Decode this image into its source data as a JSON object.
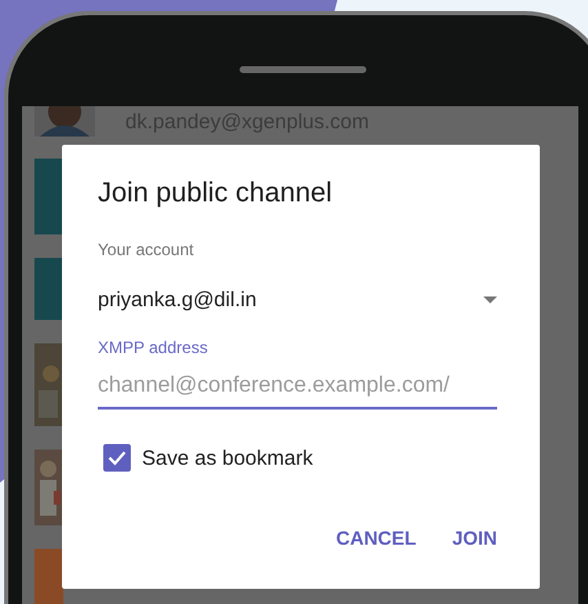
{
  "background_list": {
    "account": "dk.pandey@xgenplus.com"
  },
  "dialog": {
    "title": "Join public channel",
    "account_label": "Your account",
    "account_value": "priyanka.g@dil.in",
    "address_label": "XMPP address",
    "address_placeholder": "channel@conference.example.com/",
    "bookmark": {
      "label": "Save as bookmark",
      "checked": true
    },
    "buttons": [
      "CANCEL",
      "JOIN"
    ]
  }
}
